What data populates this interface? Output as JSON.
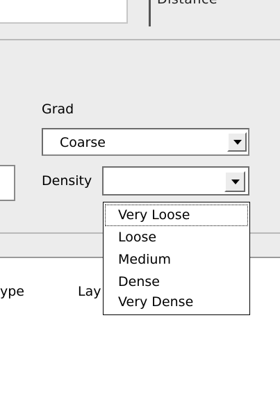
{
  "top": {
    "partial_text": "Distance"
  },
  "form": {
    "grad_label": "Grad",
    "grad_value": "Coarse",
    "density_label": "Density",
    "density_value": ""
  },
  "density_options": [
    "Very Loose",
    "Loose",
    "Medium",
    "Dense",
    "Very Dense"
  ],
  "columns": {
    "type_partial": "ype",
    "layer_partial": "Lay"
  }
}
